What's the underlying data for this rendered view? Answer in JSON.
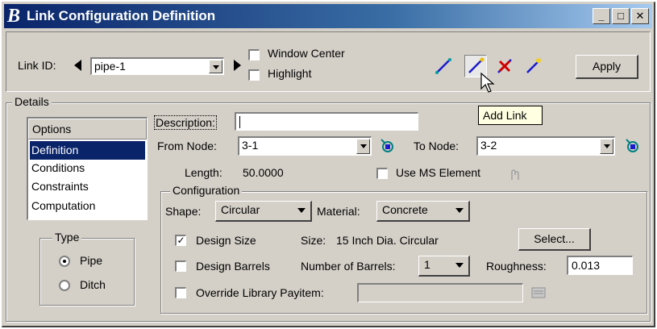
{
  "window": {
    "title": "Link Configuration Definition",
    "logo": "B"
  },
  "titlebar_buttons": {
    "minimize": "_",
    "maximize": "□",
    "close": "✕"
  },
  "toolbar": {
    "link_id_label": "Link ID:",
    "link_id_value": "pipe-1",
    "window_center": "Window Center",
    "highlight": "Highlight",
    "apply": "Apply",
    "tooltip": "Add Link"
  },
  "details": {
    "group_title": "Details",
    "options_header": "Options",
    "options": [
      "Definition",
      "Conditions",
      "Constraints",
      "Computation"
    ],
    "selected_option": "Definition",
    "type_title": "Type",
    "type_pipe": "Pipe",
    "type_ditch": "Ditch",
    "description_label": "Description:",
    "description_value": "",
    "from_node_label": "From Node:",
    "from_node_value": "3-1",
    "to_node_label": "To Node:",
    "to_node_value": "3-2",
    "length_label": "Length:",
    "length_value": "50.0000",
    "use_ms_element": "Use MS Element"
  },
  "configuration": {
    "group_title": "Configuration",
    "shape_label": "Shape:",
    "shape_value": "Circular",
    "material_label": "Material:",
    "material_value": "Concrete",
    "design_size": "Design Size",
    "size_label": "Size:",
    "size_value": "15 Inch Dia. Circular",
    "select_button": "Select...",
    "design_barrels": "Design Barrels",
    "num_barrels_label": "Number of Barrels:",
    "num_barrels_value": "1",
    "roughness_label": "Roughness:",
    "roughness_value": "0.013",
    "override_label": "Override Library Payitem:",
    "override_value": ""
  },
  "colors": {
    "title_start": "#0a246a",
    "title_end": "#a6caf0",
    "selection": "#0a246a",
    "face": "#d4d0c8"
  }
}
